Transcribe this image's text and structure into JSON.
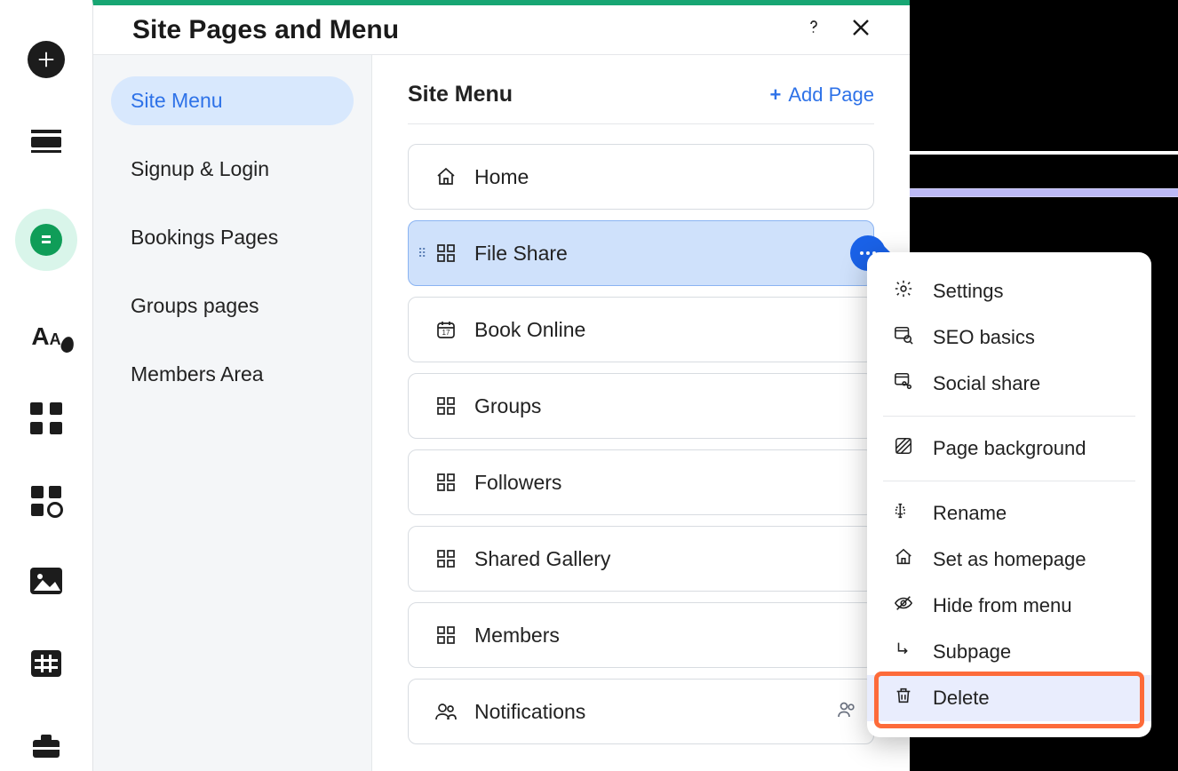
{
  "panel": {
    "title": "Site Pages and Menu"
  },
  "sidebar": {
    "items": [
      {
        "label": "Site Menu"
      },
      {
        "label": "Signup & Login"
      },
      {
        "label": "Bookings Pages"
      },
      {
        "label": "Groups pages"
      },
      {
        "label": "Members Area"
      }
    ]
  },
  "main": {
    "heading": "Site Menu",
    "add_page": "Add Page",
    "pages": [
      {
        "label": "Home"
      },
      {
        "label": "File Share"
      },
      {
        "label": "Book Online"
      },
      {
        "label": "Groups"
      },
      {
        "label": "Followers"
      },
      {
        "label": "Shared Gallery"
      },
      {
        "label": "Members"
      },
      {
        "label": "Notifications"
      }
    ]
  },
  "ctx": {
    "settings": "Settings",
    "seo": "SEO basics",
    "social": "Social share",
    "bg": "Page background",
    "rename": "Rename",
    "homepage": "Set as homepage",
    "hide": "Hide from menu",
    "subpage": "Subpage",
    "delete": "Delete"
  }
}
